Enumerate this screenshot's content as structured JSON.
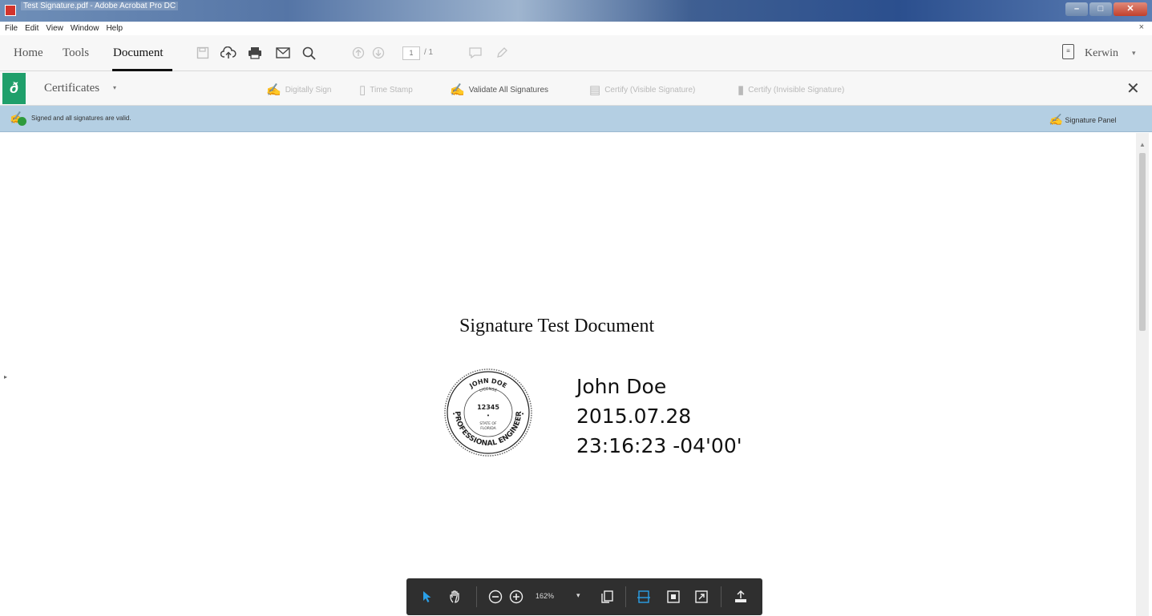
{
  "window": {
    "title": "Test Signature.pdf - Adobe Acrobat Pro DC",
    "minimize": "–",
    "maximize": "□",
    "close": "✕"
  },
  "menu": {
    "items": [
      "File",
      "Edit",
      "View",
      "Window",
      "Help"
    ],
    "close": "×"
  },
  "toolbar": {
    "tabs": [
      "Home",
      "Tools",
      "Document"
    ],
    "active_tab": "Document",
    "page_current": "1",
    "page_total": "/ 1",
    "user_name": "Kerwin",
    "user_caret": "▾"
  },
  "certificates": {
    "label": "Certificates",
    "caret": "▾",
    "tools": [
      {
        "label": "Digitally Sign",
        "enabled": false,
        "icon": "digital-sign-icon"
      },
      {
        "label": "Time Stamp",
        "enabled": false,
        "icon": "time-stamp-icon"
      },
      {
        "label": "Validate All Signatures",
        "enabled": true,
        "icon": "validate-signatures-icon"
      },
      {
        "label": "Certify (Visible Signature)",
        "enabled": false,
        "icon": "certify-visible-icon"
      },
      {
        "label": "Certify (Invisible Signature)",
        "enabled": false,
        "icon": "certify-invisible-icon"
      }
    ],
    "close": "✕"
  },
  "signature_bar": {
    "status": "Signed and all signatures are valid.",
    "panel_button": "Signature Panel"
  },
  "document": {
    "title": "Signature Test Document",
    "signer_name": "John Doe",
    "signed_date": "2015.07.28",
    "signed_time": "23:16:23 -04'00'",
    "seal": {
      "name": "JOHN DOE",
      "license_label": "LICENSE",
      "license_number": "12345",
      "state_line1": "STATE OF",
      "state_line2": "FLORIDA",
      "profession": "PROFESSIONAL ENGINEER"
    }
  },
  "float_toolbar": {
    "zoom": "162%",
    "zoom_caret": "▾"
  },
  "colors": {
    "accent_green": "#1f9f6b",
    "signature_bar": "#b4cfe3",
    "float_bar": "#2f2f2f",
    "active_blue": "#2aa0e8"
  }
}
